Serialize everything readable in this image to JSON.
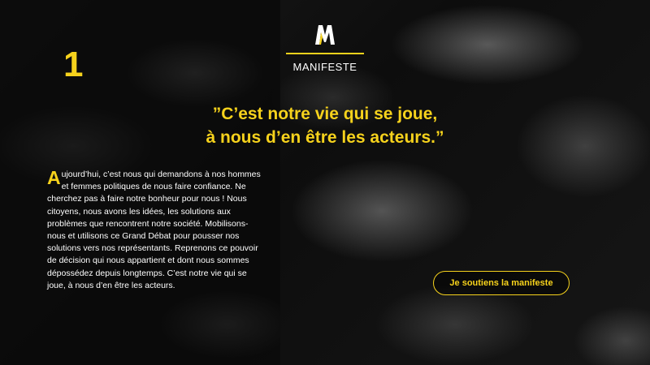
{
  "step": {
    "number": "1"
  },
  "brand": {
    "logo_icon": "m-logo-icon",
    "name": "MANIFESTE"
  },
  "quote": {
    "line1": "”C’est notre vie qui se joue,",
    "line2": "à nous d’en être les acteurs.”"
  },
  "manifesto": {
    "drop_cap": "A",
    "text": "ujourd’hui, c’est nous qui demandons à nos hommes et femmes politiques de nous faire confiance. Ne cherchez pas à faire notre bonheur pour nous ! Nous citoyens, nous avons les idées, les solutions aux problèmes que rencontrent notre société. Mobilisons-nous et utilisons ce Grand Débat pour pousser nos solutions vers nos représentants. Reprenons ce pouvoir de décision qui nous appartient et dont nous sommes dépossédez depuis longtemps. C’est notre vie qui se joue, à nous d’en être les acteurs."
  },
  "cta": {
    "label": "Je soutiens la manifeste"
  },
  "colors": {
    "accent": "#f6d21c",
    "text": "#ffffff",
    "background": "#0b0b0b"
  }
}
